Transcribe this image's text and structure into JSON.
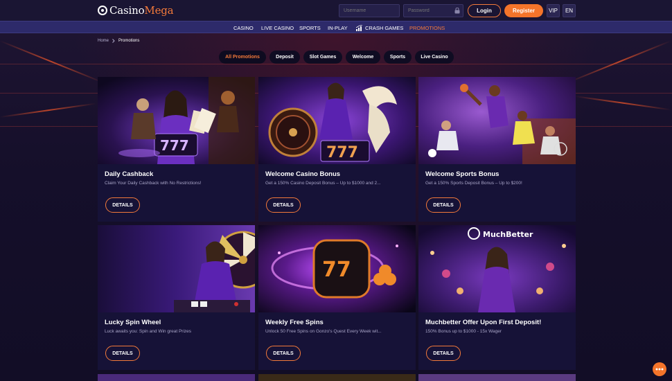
{
  "header": {
    "logo_main": "Casino",
    "logo_accent": "Mega",
    "username_placeholder": "Username",
    "password_placeholder": "Password",
    "login_label": "Login",
    "register_label": "Register",
    "vip_label": "VIP",
    "lang_label": "EN"
  },
  "nav": {
    "items": [
      "CASINO",
      "LIVE CASINO",
      "SPORTS",
      "IN-PLAY",
      "CRASH GAMES",
      "PROMOTIONS"
    ],
    "active": "PROMOTIONS"
  },
  "breadcrumb": {
    "home": "Home",
    "current": "Promotions"
  },
  "filters": [
    "All Promotions",
    "Deposit",
    "Slot Games",
    "Welcome",
    "Sports",
    "Live Casino"
  ],
  "promotions": [
    {
      "title": "Daily Cashback",
      "desc": "Claim Your Daily Cashback with No Restrictions!",
      "button": "DETAILS"
    },
    {
      "title": "Welcome Casino Bonus",
      "desc": "Get a 150% Casino Deposit Bonus – Up to $1000 and 2...",
      "button": "DETAILS"
    },
    {
      "title": "Welcome Sports Bonus",
      "desc": "Get a 150% Sports Deposit Bonus – Up to $200!",
      "button": "DETAILS"
    },
    {
      "title": "Lucky Spin Wheel",
      "desc": "Luck awaits you: Spin and Win great Prizes",
      "button": "DETAILS"
    },
    {
      "title": "Weekly Free Spins",
      "desc": "Unlock 50 Free Spins on Gonzo's Quest Every Week wit...",
      "button": "DETAILS"
    },
    {
      "title": "Muchbetter Offer Upon First Deposit!",
      "desc": "150% Bonus up to $1000 - 15x Wager",
      "button": "DETAILS"
    }
  ],
  "banner_text": {
    "muchbetter": "MuchBetter",
    "slot_777": "777",
    "slot_77": "77"
  },
  "colors": {
    "accent": "#f47a3a",
    "nav_bg": "#2d2a6a",
    "card_bg": "#161237"
  }
}
